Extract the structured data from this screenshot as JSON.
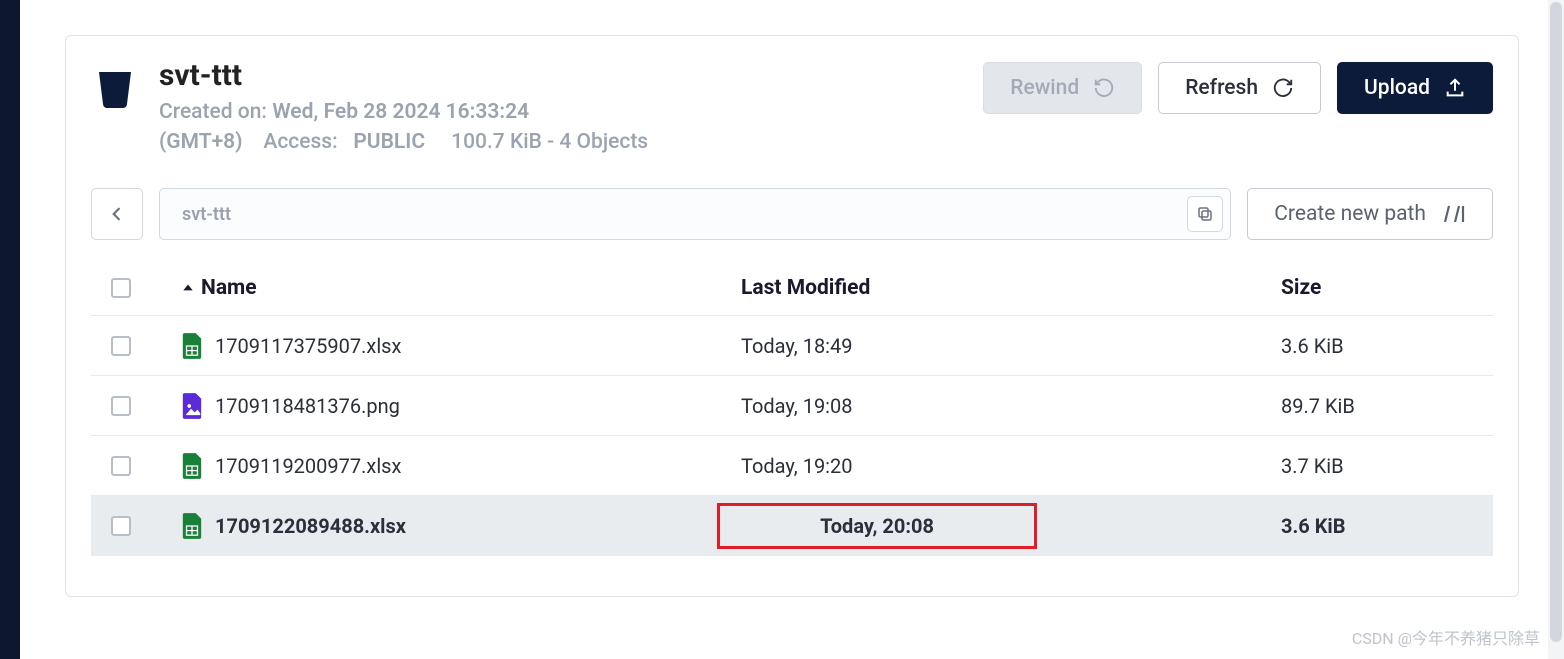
{
  "bucket": {
    "name": "svt-ttt",
    "created_label": "Created on:",
    "created_value": "Wed, Feb 28 2024 16:33:24",
    "tz": "(GMT+8)",
    "access_label": "Access:",
    "access_value": "PUBLIC",
    "stats": "100.7 KiB - 4 Objects"
  },
  "actions": {
    "rewind": "Rewind",
    "refresh": "Refresh",
    "upload": "Upload"
  },
  "path": {
    "value": "svt-ttt",
    "create_label": "Create new path"
  },
  "columns": {
    "name": "Name",
    "modified": "Last Modified",
    "size": "Size"
  },
  "files": [
    {
      "name": "1709117375907.xlsx",
      "modified": "Today, 18:49",
      "size": "3.6 KiB",
      "type": "xlsx",
      "highlighted": false
    },
    {
      "name": "1709118481376.png",
      "modified": "Today, 19:08",
      "size": "89.7 KiB",
      "type": "png",
      "highlighted": false
    },
    {
      "name": "1709119200977.xlsx",
      "modified": "Today, 19:20",
      "size": "3.7 KiB",
      "type": "xlsx",
      "highlighted": false
    },
    {
      "name": "1709122089488.xlsx",
      "modified": "Today, 20:08",
      "size": "3.6 KiB",
      "type": "xlsx",
      "highlighted": true
    }
  ],
  "watermark": "CSDN @今年不养猪只除草"
}
